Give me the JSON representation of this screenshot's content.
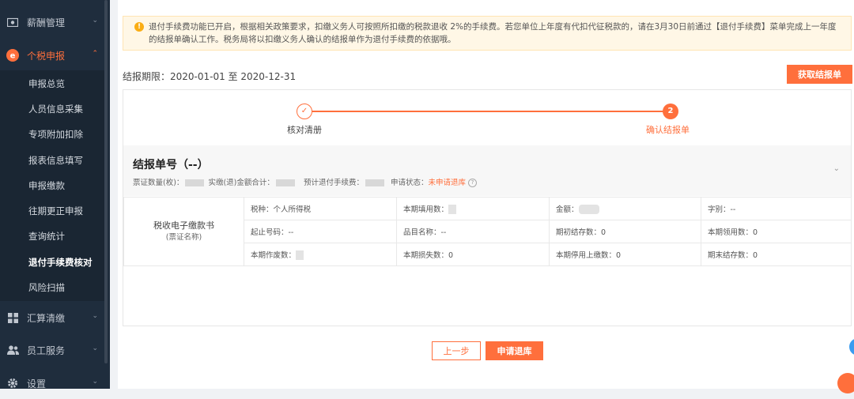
{
  "sidebar": {
    "groups": [
      {
        "label": "薪酬管理",
        "icon": "payroll-icon"
      },
      {
        "label": "个税申报",
        "icon": "tax-icon"
      },
      {
        "label": "汇算清缴",
        "icon": "grid-icon"
      },
      {
        "label": "员工服务",
        "icon": "people-icon"
      },
      {
        "label": "设置",
        "icon": "gear-icon"
      }
    ],
    "sub_items": [
      "申报总览",
      "人员信息采集",
      "专项附加扣除",
      "报表信息填写",
      "申报缴款",
      "往期更正申报",
      "查询统计",
      "退付手续费核对",
      "风险扫描"
    ]
  },
  "notice": {
    "icon": "warning-icon",
    "text": "退付手续费功能已开启，根据相关政策要求，扣缴义务人可按照所扣缴的税款退收 2%的手续费。若您单位上年度有代扣代征税款的，请在3月30日前通过【退付手续费】菜单完成上一年度的结报单确认工作。税务局将以扣缴义务人确认的结报单作为退付手续费的依据哦。"
  },
  "period": {
    "label": "结报期限：2020-01-01 至 2020-12-31"
  },
  "fetch_button": "获取结报单",
  "steps": [
    {
      "number": "1",
      "label": "核对清册"
    },
    {
      "number": "2",
      "label": "确认结报单"
    }
  ],
  "summary": {
    "title": "结报单号（--）",
    "count_label": "票证数量(枚)：",
    "amount_label": "实缴(退)金额合计：",
    "fee_label": "预计退付手续费：",
    "status_label": "申请状态：",
    "status_value": "未申请退库"
  },
  "table": {
    "name": "税收电子缴款书",
    "name_sub": "(票证名称)",
    "rows": [
      [
        "税种：个人所得税",
        "本期填用数：",
        "金额：",
        "字别：--"
      ],
      [
        "起止号码：--",
        "品目名称：--",
        "期初结存数：0",
        "本期领用数：0"
      ],
      [
        "本期作废数：",
        "本期损失数：0",
        "本期停用上缴数：0",
        "期末结存数：0"
      ]
    ]
  },
  "buttons": {
    "prev": "上一步",
    "apply": "申请退库"
  },
  "colors": {
    "accent": "#ff6f3c",
    "sidebar_bg": "#1f2d3d",
    "notice_bg": "#fff7e6"
  }
}
